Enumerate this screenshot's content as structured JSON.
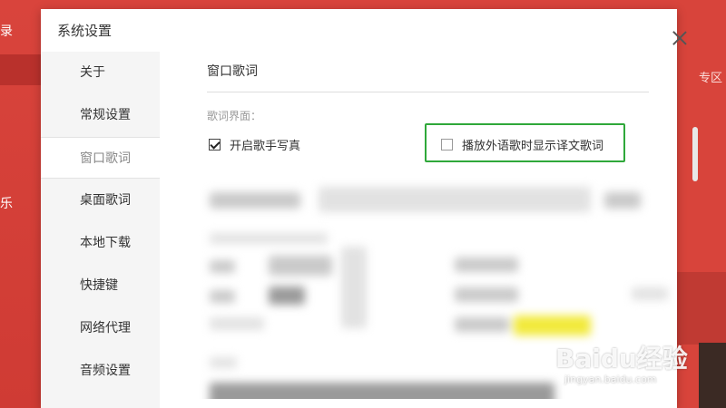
{
  "background_app": {
    "left_text_top": "录",
    "left_text_mid": "乐",
    "right_tab": "专区"
  },
  "dialog": {
    "title": "系统设置",
    "sidebar": {
      "items": [
        {
          "label": "关于",
          "active": false
        },
        {
          "label": "常规设置",
          "active": false
        },
        {
          "label": "窗口歌词",
          "active": true
        },
        {
          "label": "桌面歌词",
          "active": false
        },
        {
          "label": "本地下载",
          "active": false
        },
        {
          "label": "快捷键",
          "active": false
        },
        {
          "label": "网络代理",
          "active": false
        },
        {
          "label": "音频设置",
          "active": false
        }
      ]
    },
    "content": {
      "title": "窗口歌词",
      "section_label": "歌词界面：",
      "options": [
        {
          "label": "开启歌手写真",
          "checked": true
        },
        {
          "label": "播放外语歌时显示译文歌词",
          "checked": false
        }
      ]
    }
  },
  "watermark": {
    "text": "Baidu经验",
    "sub": "jingyan.baidu.com"
  },
  "colors": {
    "brand_red": "#d9443c",
    "highlight_green": "#2fa83a"
  }
}
